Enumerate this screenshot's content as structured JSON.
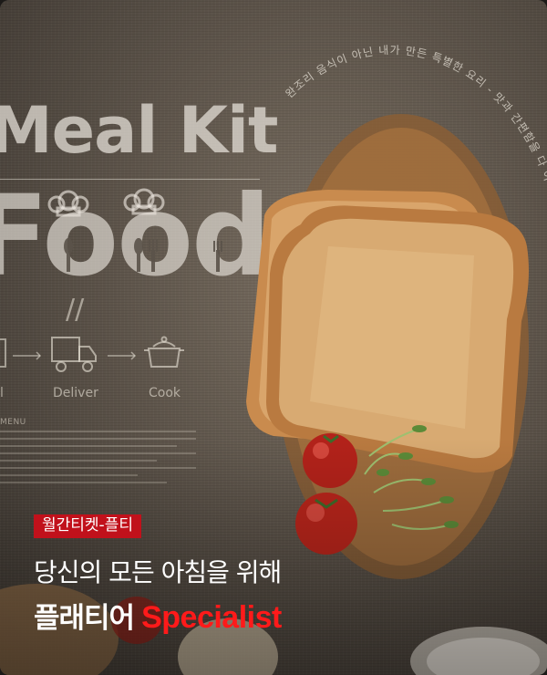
{
  "background": {
    "title_line": "Meal Kit",
    "title_big": "Food",
    "slash_mark": "//",
    "steps": [
      "l",
      "Deliver",
      "Cook"
    ],
    "menu_label": "MENU",
    "arc_text": "완조리 음식이 아닌 내가 만든 특별한 요리 - 맛과 간편함을 다 이어는"
  },
  "badge": {
    "text": "월간티켓-플티"
  },
  "headline": {
    "line1": "당신의 모든 아침을 위해",
    "line2_main": "플래티어",
    "line2_accent": "Specialist"
  },
  "colors": {
    "badge_bg": "#c1111b",
    "accent": "#ff1a1a"
  },
  "icons": [
    "van-icon",
    "pot-icon",
    "arrow-icon",
    "chef-hat-icon",
    "spoon-icon",
    "fork-icon"
  ]
}
